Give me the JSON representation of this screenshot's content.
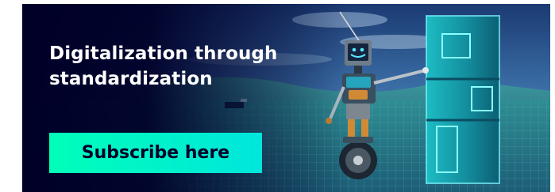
{
  "banner": {
    "headline": "Digitalization through standardization",
    "cta_label": "Subscribe here",
    "illustration": "robot-on-unicycle-beside-giant-block-number-icon",
    "colors": {
      "background_navy": "#000028",
      "cta_start": "#00ffb9",
      "cta_end": "#00e6dc",
      "cta_text": "#000028",
      "headline_text": "#ffffff"
    }
  }
}
